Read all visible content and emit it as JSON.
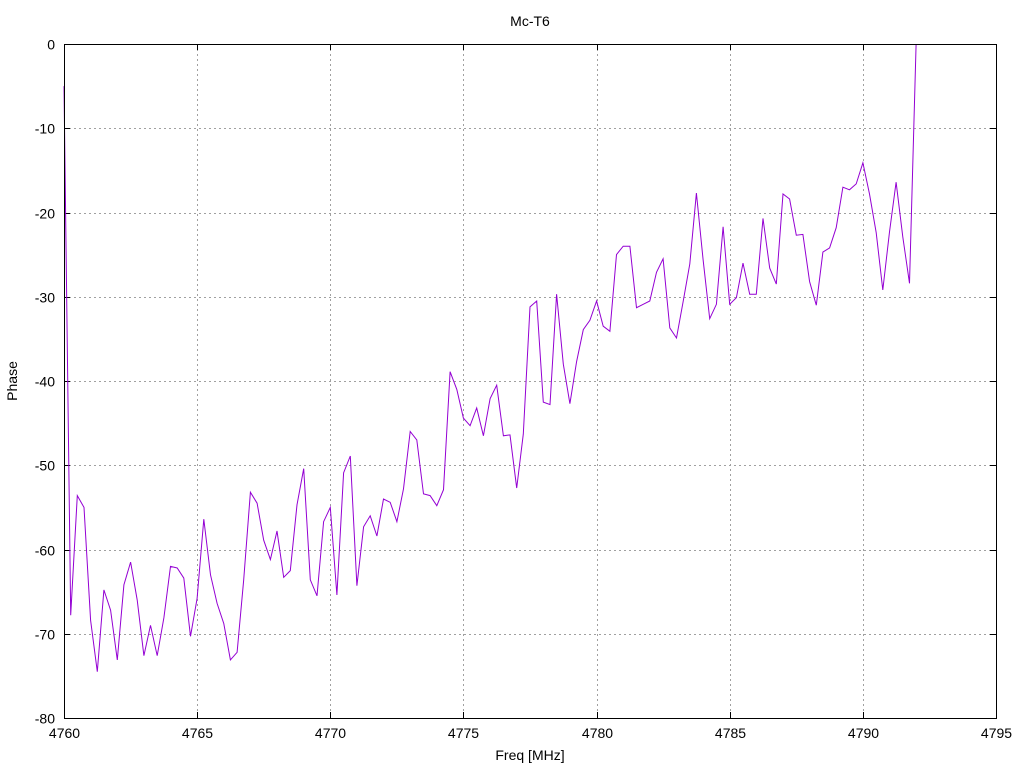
{
  "chart_data": {
    "type": "line",
    "title": "Mc-T6",
    "xlabel": "Freq [MHz]",
    "ylabel": "Phase",
    "xlim": [
      4760,
      4795
    ],
    "ylim": [
      -80,
      0
    ],
    "xticks": [
      4760,
      4765,
      4770,
      4775,
      4780,
      4785,
      4790,
      4795
    ],
    "yticks": [
      0,
      -10,
      -20,
      -30,
      -40,
      -50,
      -60,
      -70,
      -80
    ],
    "grid": true,
    "line_color": "#9400d3",
    "x_start": 4760,
    "x_step": 0.25,
    "series": [
      {
        "name": "Mc-T6",
        "values": [
          -5,
          -67.8,
          -53.6,
          -55,
          -68.4,
          -74.5,
          -64.8,
          -67.2,
          -73.1,
          -64.2,
          -61.5,
          -66,
          -72.6,
          -69,
          -72.6,
          -68.1,
          -62,
          -62.2,
          -63.4,
          -70.3,
          -65.8,
          -56.4,
          -63,
          -66.4,
          -68.8,
          -73.1,
          -72.2,
          -63.6,
          -53.2,
          -54.5,
          -58.9,
          -61.2,
          -57.8,
          -63.3,
          -62.5,
          -54.7,
          -50.4,
          -63.6,
          -65.5,
          -56.7,
          -55,
          -65.4,
          -50.9,
          -48.9,
          -64.3,
          -57.3,
          -56,
          -58.4,
          -54,
          -54.4,
          -56.7,
          -52.8,
          -46,
          -47,
          -53.4,
          -53.6,
          -54.8,
          -52.9,
          -38.9,
          -41,
          -44.4,
          -45.3,
          -43.2,
          -46.5,
          -42.1,
          -40.5,
          -46.5,
          -46.4,
          -52.7,
          -46.3,
          -31.2,
          -30.5,
          -42.5,
          -42.8,
          -29.7,
          -38,
          -42.7,
          -37.7,
          -33.9,
          -32.8,
          -30.5,
          -33.5,
          -34.1,
          -25,
          -24,
          -24,
          -31.3,
          -30.9,
          -30.5,
          -27.1,
          -25.5,
          -33.7,
          -34.9,
          -30.6,
          -26.1,
          -17.7,
          -25.6,
          -32.6,
          -30.9,
          -21.7,
          -30.9,
          -30.1,
          -26,
          -29.7,
          -29.7,
          -20.7,
          -26.6,
          -28.5,
          -17.8,
          -18.4,
          -22.7,
          -22.6,
          -28.2,
          -31,
          -24.7,
          -24.2,
          -21.8,
          -17,
          -17.3,
          -16.6,
          -14.1,
          -17.8,
          -22.4,
          -29.2,
          -22.3,
          -16.4,
          -22.9,
          -28.4,
          0
        ]
      }
    ]
  }
}
